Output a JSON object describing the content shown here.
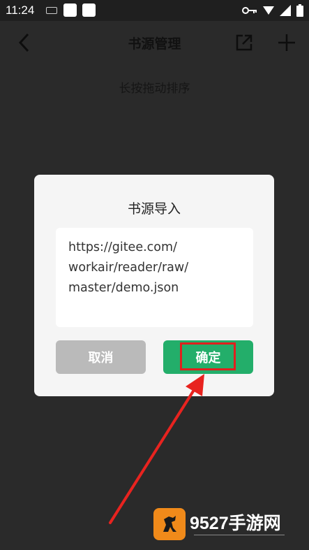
{
  "status_bar": {
    "time": "11:24"
  },
  "app_bar": {
    "title": "书源管理"
  },
  "hint": "长按拖动排序",
  "dialog": {
    "title": "书源导入",
    "url_value": "https://gitee.com/\nworkair/reader/raw/\nmaster/demo.json",
    "cancel_label": "取消",
    "confirm_label": "确定"
  },
  "watermark": {
    "text": "9527手游网"
  },
  "colors": {
    "confirm": "#23ae6a",
    "cancel": "#bababa",
    "highlight": "#e0201e"
  }
}
